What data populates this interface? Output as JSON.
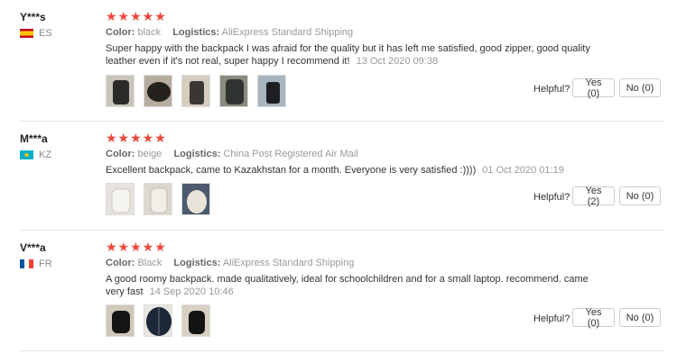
{
  "labels": {
    "color": "Color:",
    "logistics": "Logistics:",
    "helpful": "Helpful?"
  },
  "star_glyphs": "★★★★★",
  "reviews": [
    {
      "user": "Y***s",
      "country": "ES",
      "flag": "es-flag",
      "stars": 5,
      "color": "black",
      "logistics": "AliExpress Standard Shipping",
      "text": "Super happy with the backpack I was afraid for the quality but it has left me satisfied, good zipper, good quality leather even if it's not real, super happy I recommend it!",
      "date": "13 Oct 2020 09:38",
      "yes": "Yes (0)",
      "no": "No (0)"
    },
    {
      "user": "M***a",
      "country": "KZ",
      "flag": "kz-flag",
      "stars": 5,
      "color": "beige",
      "logistics": "China Post Registered Air Mail",
      "text": "Excellent backpack, came to Kazakhstan for a month. Everyone is very satisfied :))))",
      "date": "01 Oct 2020 01:19",
      "yes": "Yes (2)",
      "no": "No (0)"
    },
    {
      "user": "V***a",
      "country": "FR",
      "flag": "fr-flag",
      "stars": 5,
      "color": "Black",
      "logistics": "AliExpress Standard Shipping",
      "text": "A good roomy backpack. made qualitatively, ideal for schoolchildren and for a small laptop. recommend. came very fast",
      "date": "14 Sep 2020 10:46",
      "yes": "Yes (0)",
      "no": "No (0)"
    }
  ],
  "colors": {
    "star": "#f0463b",
    "muted": "#999999",
    "divider": "#e8e8e8"
  }
}
